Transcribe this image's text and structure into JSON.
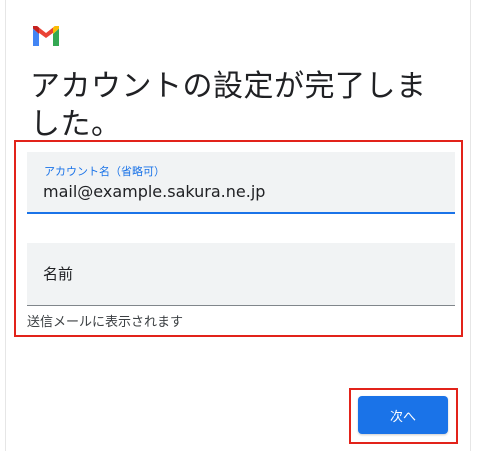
{
  "app": {
    "logo_icon": "gmail-m-logo"
  },
  "page": {
    "title": "アカウントの設定が完了しました。"
  },
  "account_field": {
    "label": "アカウント名（省略可）",
    "value": "mail@example.sakura.ne.jp"
  },
  "name_field": {
    "placeholder": "名前",
    "value": ""
  },
  "helper_text": "送信メールに表示されます",
  "next_button": {
    "label": "次へ"
  },
  "colors": {
    "accent_blue": "#1a73e8",
    "highlight_red": "#e2231a",
    "field_background": "#f1f3f4",
    "text_primary": "#202124"
  }
}
